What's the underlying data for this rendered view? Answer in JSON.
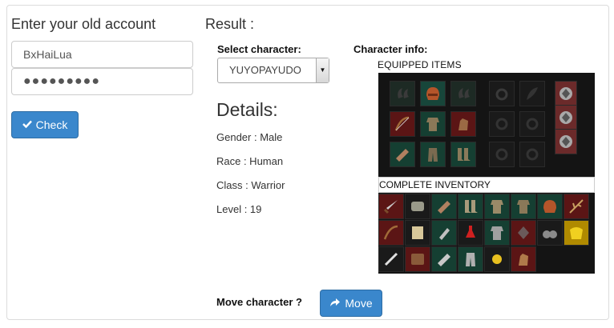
{
  "left": {
    "heading": "Enter your old account",
    "username_value": "BxHaiLua",
    "password_value": "●●●●●●●●●",
    "check_label": "Check"
  },
  "result": {
    "heading": "Result :",
    "select_label": "Select character:",
    "selected_character": "YUYOPAYUDO",
    "details_heading": "Details:",
    "gender": "Gender : Male",
    "race": "Race : Human",
    "class": "Class : Warrior",
    "level": "Level : 19",
    "character_info_label": "Character info:",
    "equipped_label": "EQUIPPED ITEMS",
    "inventory_label": "COMPLETE INVENTORY",
    "move_question": "Move character ?",
    "move_label": "Move"
  },
  "equipped_icons": [
    "ear-icon",
    "helmet-icon",
    "ear-icon",
    "amulet-icon",
    "leaf-icon",
    "seal-icon",
    "bow-icon",
    "armor-icon",
    "glove-icon",
    "empty-ring-icon",
    "empty-ring-icon",
    "seal-icon",
    "bracer-icon",
    "pants-icon",
    "boots-icon",
    "empty-ring-icon",
    "empty-ring-icon"
  ],
  "inventory_icons": [
    "sword-icon",
    "stone-icon",
    "bracer-icon",
    "boots-icon",
    "armor-icon",
    "armor-icon",
    "helmet-icon",
    "branch-icon",
    "bow-icon",
    "scroll-icon",
    "grenade-icon",
    "potion-icon",
    "armor-icon",
    "stone-icon",
    "binoculars-icon",
    "cloth-icon",
    "bone-icon",
    "leather-icon",
    "bracer-icon",
    "pants-icon",
    "flower-icon",
    "glove-icon"
  ],
  "colors": {
    "button_bg": "#3a87cc",
    "panel_border": "#dcdcdc",
    "dark_grid": "#141414"
  }
}
